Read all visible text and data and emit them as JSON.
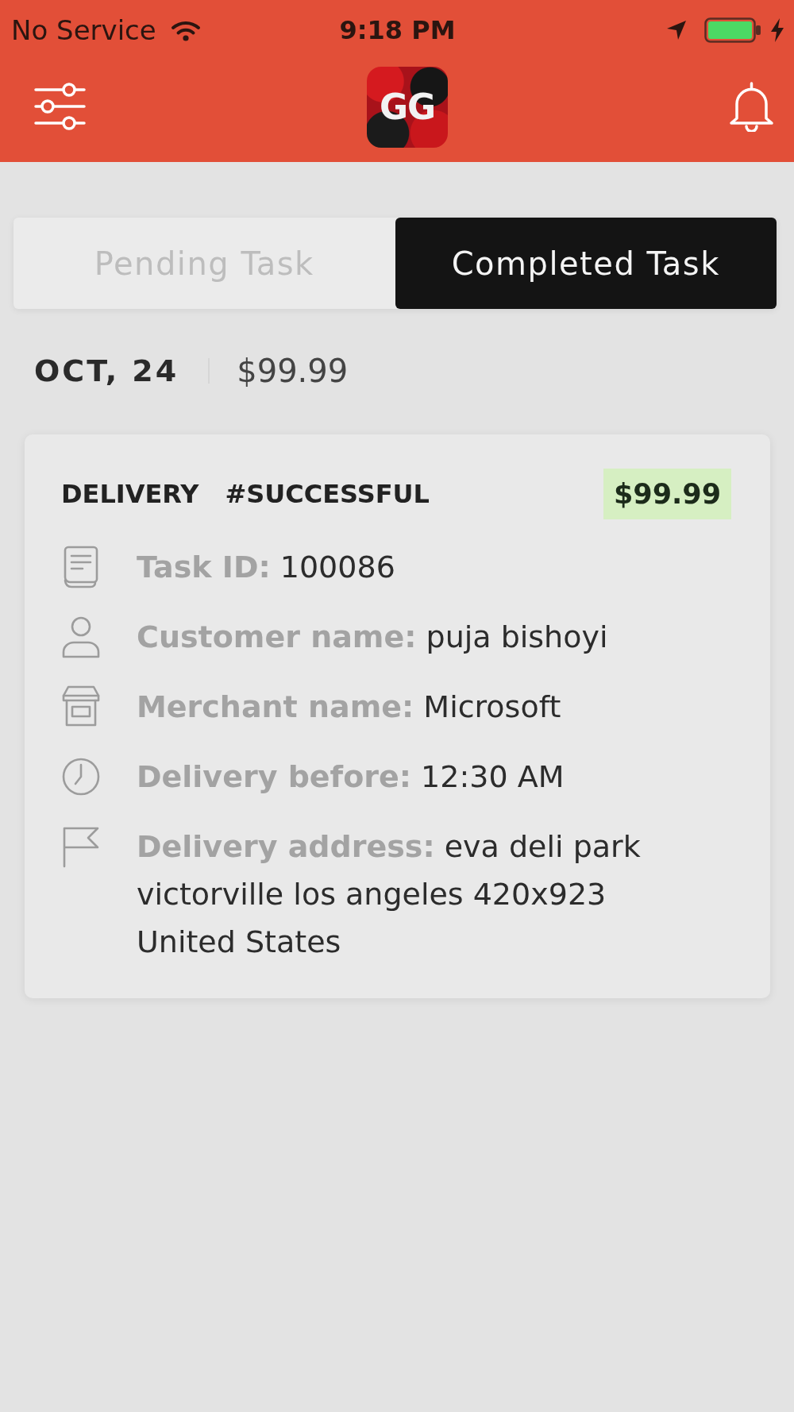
{
  "status_bar": {
    "carrier": "No Service",
    "time": "9:18 PM"
  },
  "header": {
    "logo_text": "GG"
  },
  "tabs": [
    {
      "label": "Pending Task",
      "selected": false
    },
    {
      "label": "Completed Task",
      "selected": true
    }
  ],
  "summary": {
    "date": "OCT, 24",
    "amount": "$99.99"
  },
  "tasks": [
    {
      "type": "DELIVERY",
      "status": "#SUCCESSFUL",
      "amount": "$99.99",
      "details": [
        {
          "kind": "id",
          "label": "Task ID:",
          "value": "100086"
        },
        {
          "kind": "customer",
          "label": "Customer name:",
          "value": "puja bishoyi"
        },
        {
          "kind": "merchant",
          "label": "Merchant name:",
          "value": "Microsoft"
        },
        {
          "kind": "deadline",
          "label": "Delivery before:",
          "value": "12:30 AM"
        },
        {
          "kind": "address",
          "label": "Delivery address:",
          "value": "eva deli park victorville los angeles 420x923 United States"
        }
      ]
    }
  ]
}
